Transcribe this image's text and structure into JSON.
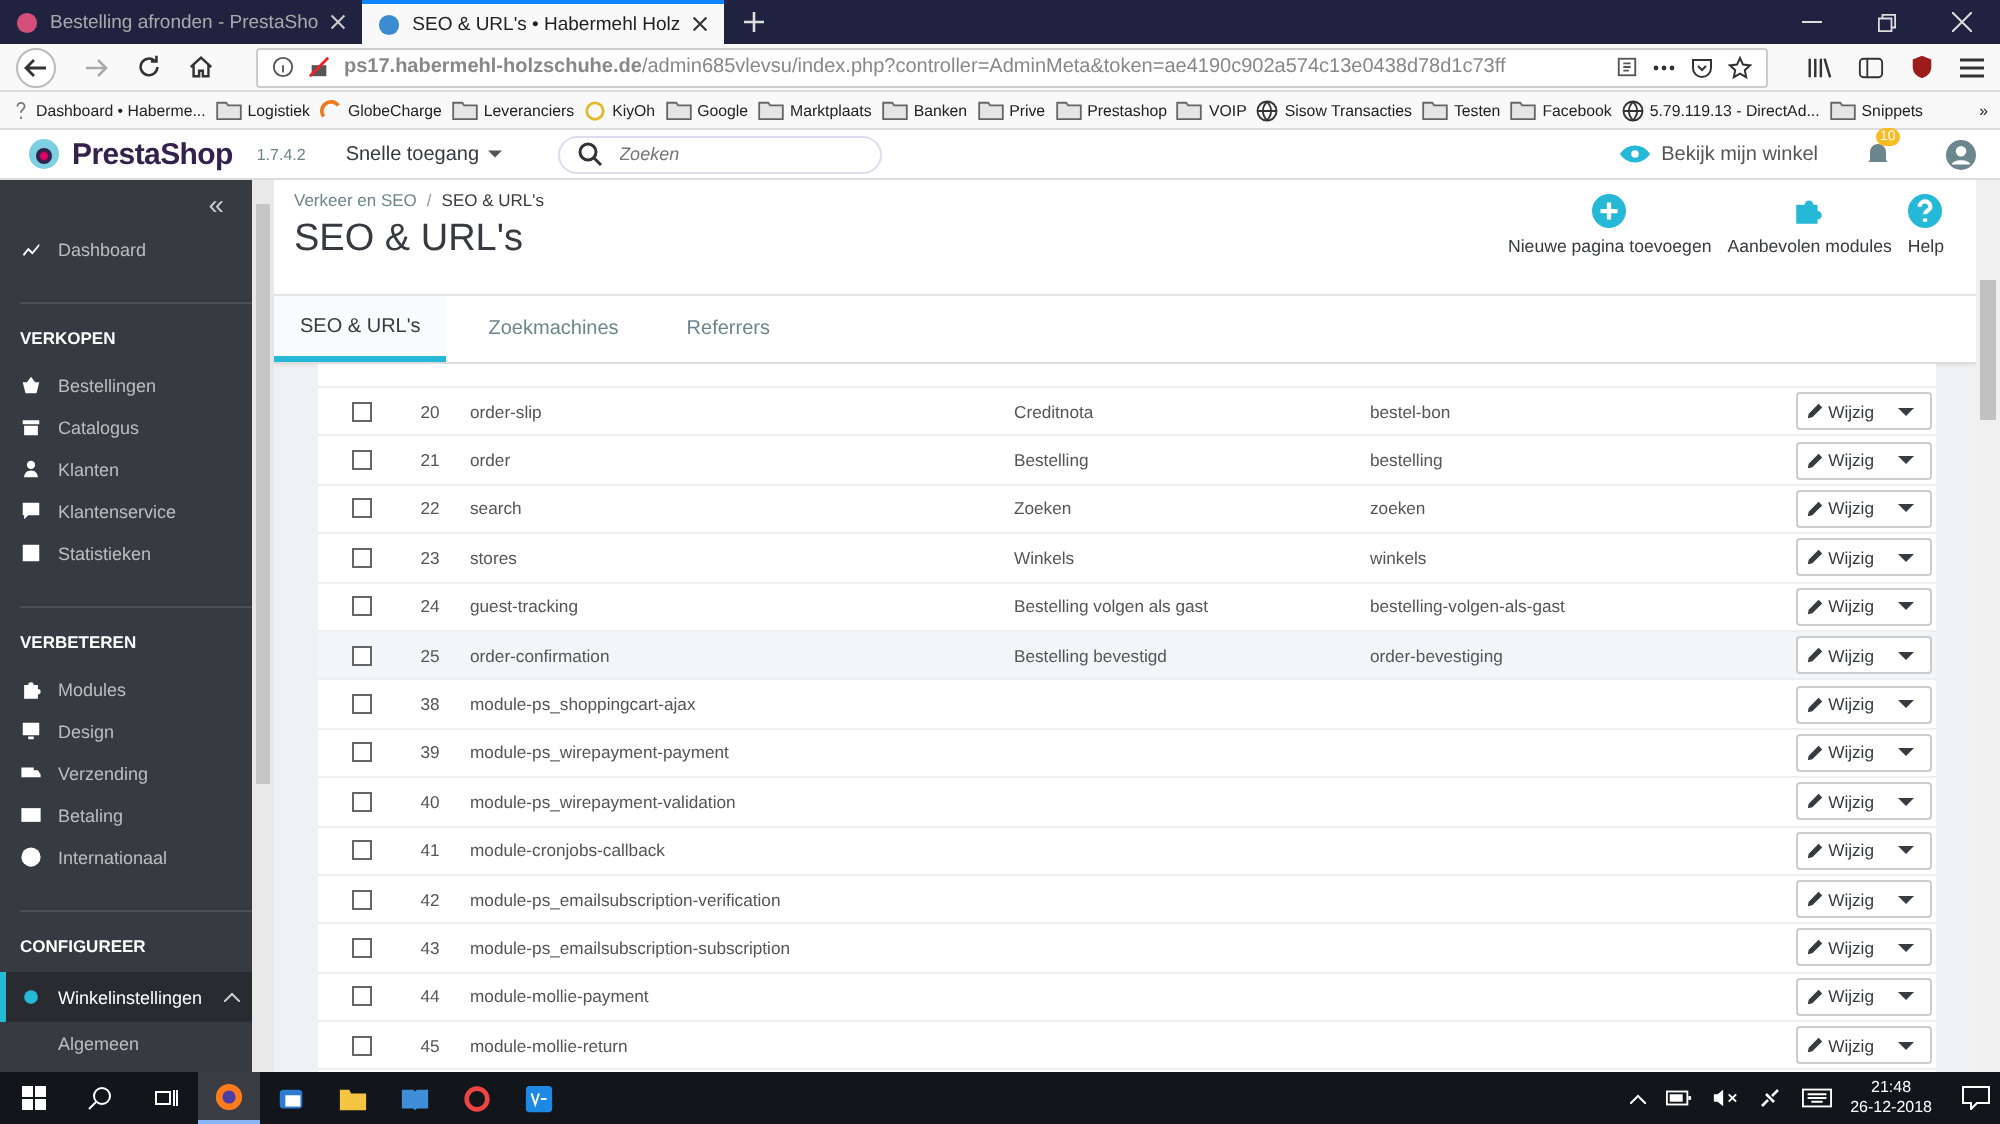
{
  "browser": {
    "tabs": [
      {
        "title": "Bestelling afronden - PrestaSho",
        "selected": false
      },
      {
        "title": "SEO & URL's • Habermehl Holz",
        "selected": true
      }
    ],
    "url": "**ps17.habermehl-holzschuhe.de**/admin685vlevsu/index.php?controller=AdminMeta&token=ae4190c902a574c13e0438d78d1c73ff",
    "bookmarks": [
      {
        "label": "Dashboard • Haberme...",
        "kind": "page"
      },
      {
        "label": "Logistiek",
        "kind": "folder"
      },
      {
        "label": "GlobeCharge",
        "kind": "charge"
      },
      {
        "label": "Leveranciers",
        "kind": "folder"
      },
      {
        "label": "KiyOh",
        "kind": "ring"
      },
      {
        "label": "Google",
        "kind": "folder"
      },
      {
        "label": "Marktplaats",
        "kind": "folder"
      },
      {
        "label": "Banken",
        "kind": "folder"
      },
      {
        "label": "Prive",
        "kind": "folder"
      },
      {
        "label": "Prestashop",
        "kind": "folder"
      },
      {
        "label": "VOIP",
        "kind": "folder"
      },
      {
        "label": "Sisow Transacties",
        "kind": "globe"
      },
      {
        "label": "Testen",
        "kind": "folder"
      },
      {
        "label": "Facebook",
        "kind": "folder"
      },
      {
        "label": "5.79.119.13 - DirectAd...",
        "kind": "globe"
      },
      {
        "label": "Snippets",
        "kind": "folder"
      }
    ],
    "more": "»"
  },
  "header": {
    "logo": "PrestaShop",
    "version": "1.7.4.2",
    "quick_access": "Snelle toegang",
    "search": {
      "placeholder": "Zoeken"
    },
    "view_shop": "Bekijk mijn winkel",
    "notifications": "10"
  },
  "sidebar": {
    "collapse": "«",
    "sections": [
      {
        "items": [
          {
            "label": "Dashboard",
            "selected": false
          }
        ]
      },
      {
        "title": "VERKOPEN",
        "items": [
          {
            "label": "Bestellingen",
            "selected": false
          },
          {
            "label": "Catalogus",
            "selected": false
          },
          {
            "label": "Klanten",
            "selected": false
          },
          {
            "label": "Klantenservice",
            "selected": false
          },
          {
            "label": "Statistieken",
            "selected": false
          }
        ]
      },
      {
        "title": "VERBETEREN",
        "items": [
          {
            "label": "Modules",
            "selected": false
          },
          {
            "label": "Design",
            "selected": false
          },
          {
            "label": "Verzending",
            "selected": false
          },
          {
            "label": "Betaling",
            "selected": false
          },
          {
            "label": "Internationaal",
            "selected": false
          }
        ]
      },
      {
        "title": "CONFIGUREER",
        "items": [
          {
            "label": "Winkelinstellingen",
            "selected": true,
            "expanded": true,
            "children": [
              {
                "label": "Algemeen"
              }
            ]
          }
        ]
      }
    ]
  },
  "page": {
    "breadcrumb": [
      "Verkeer en SEO",
      "SEO & URL's"
    ],
    "breadcrumb_separator": "/",
    "title": "SEO & URL's",
    "toolbar": [
      {
        "label": "Nieuwe pagina toevoegen",
        "kind": "add"
      },
      {
        "label": "Aanbevolen modules",
        "kind": "puzzle"
      },
      {
        "label": "Help",
        "kind": "help"
      }
    ],
    "tabs": [
      {
        "label": "SEO & URL's",
        "selected": true
      },
      {
        "label": "Zoekmachines",
        "selected": false
      },
      {
        "label": "Referrers",
        "selected": false
      }
    ]
  },
  "table": {
    "rows": [
      {
        "id": "20",
        "page": "order-slip",
        "title": "Creditnota",
        "url": "bestel-bon",
        "action": "Wijzig",
        "checked": false,
        "highlighted": false
      },
      {
        "id": "21",
        "page": "order",
        "title": "Bestelling",
        "url": "bestelling",
        "action": "Wijzig",
        "checked": false,
        "highlighted": false
      },
      {
        "id": "22",
        "page": "search",
        "title": "Zoeken",
        "url": "zoeken",
        "action": "Wijzig",
        "checked": false,
        "highlighted": false
      },
      {
        "id": "23",
        "page": "stores",
        "title": "Winkels",
        "url": "winkels",
        "action": "Wijzig",
        "checked": false,
        "highlighted": false
      },
      {
        "id": "24",
        "page": "guest-tracking",
        "title": "Bestelling volgen als gast",
        "url": "bestelling-volgen-als-gast",
        "action": "Wijzig",
        "checked": false,
        "highlighted": false
      },
      {
        "id": "25",
        "page": "order-confirmation",
        "title": "Bestelling bevestigd",
        "url": "order-bevestiging",
        "action": "Wijzig",
        "checked": false,
        "highlighted": true
      },
      {
        "id": "38",
        "page": "module-ps_shoppingcart-ajax",
        "action": "Wijzig",
        "checked": false,
        "highlighted": false
      },
      {
        "id": "39",
        "page": "module-ps_wirepayment-payment",
        "action": "Wijzig",
        "checked": false,
        "highlighted": false
      },
      {
        "id": "40",
        "page": "module-ps_wirepayment-validation",
        "action": "Wijzig",
        "checked": false,
        "highlighted": false
      },
      {
        "id": "41",
        "page": "module-cronjobs-callback",
        "action": "Wijzig",
        "checked": false,
        "highlighted": false
      },
      {
        "id": "42",
        "page": "module-ps_emailsubscription-verification",
        "action": "Wijzig",
        "checked": false,
        "highlighted": false
      },
      {
        "id": "43",
        "page": "module-ps_emailsubscription-subscription",
        "action": "Wijzig",
        "checked": false,
        "highlighted": false
      },
      {
        "id": "44",
        "page": "module-mollie-payment",
        "action": "Wijzig",
        "checked": false,
        "highlighted": false
      },
      {
        "id": "45",
        "page": "module-mollie-return",
        "action": "Wijzig",
        "checked": false,
        "highlighted": false
      }
    ]
  },
  "taskbar": {
    "time": "21:48",
    "date": "26-12-2018"
  }
}
